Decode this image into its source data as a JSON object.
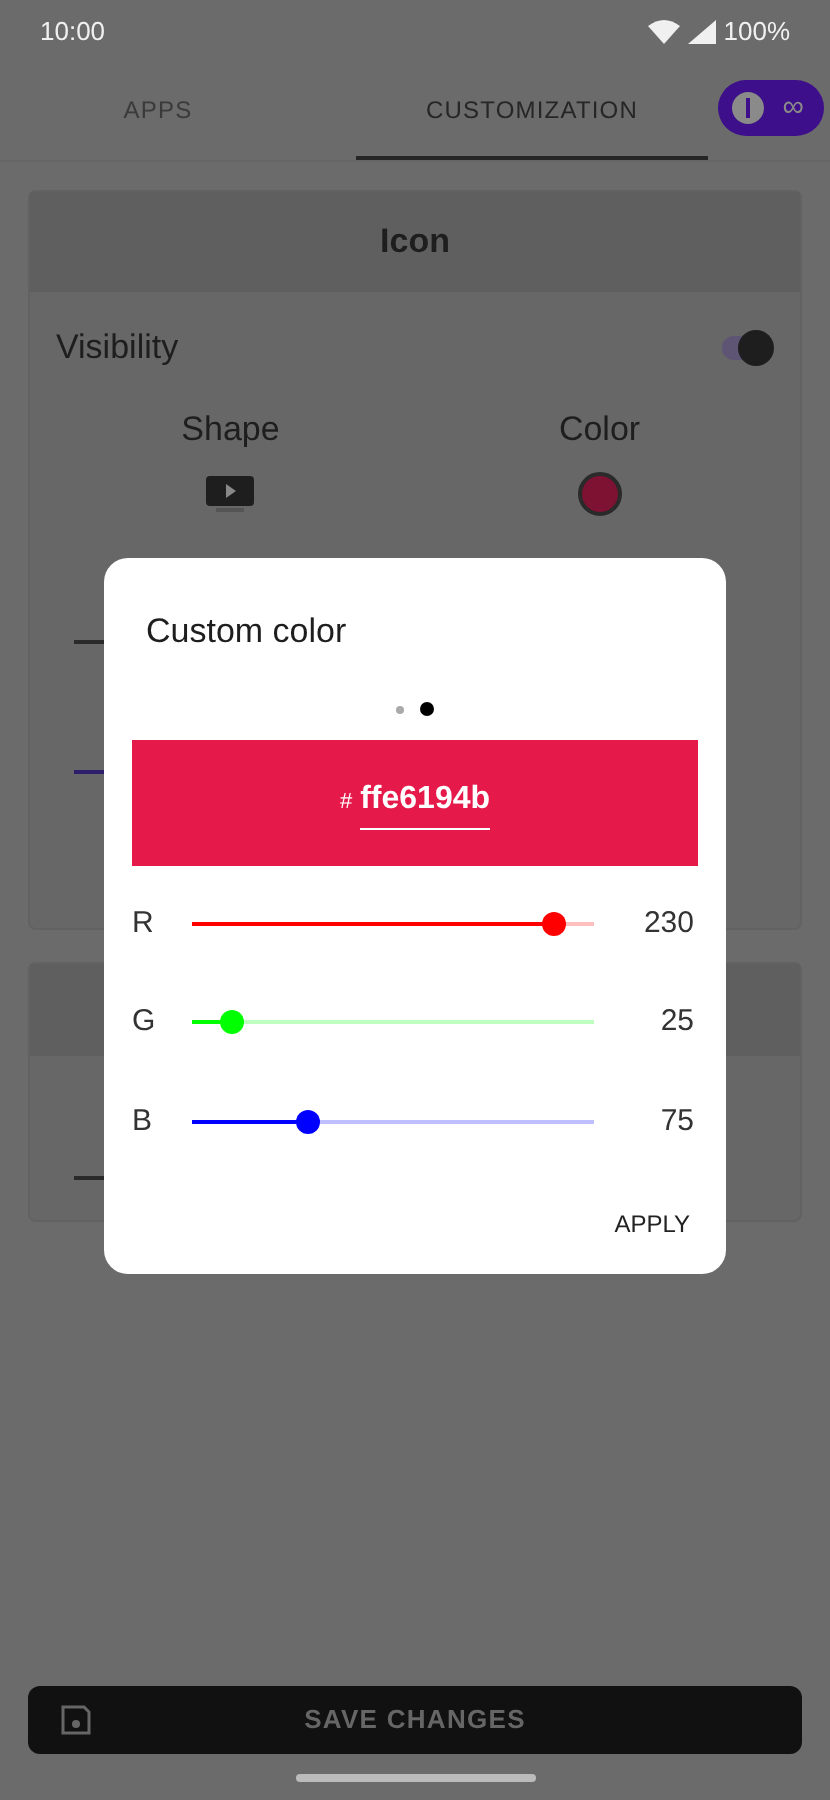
{
  "status_bar": {
    "time": "10:00",
    "battery": "100%"
  },
  "tabs": [
    {
      "label": "APPS",
      "selected": false
    },
    {
      "label": "CUSTOMIZATION",
      "selected": true
    }
  ],
  "premium_badge": {
    "label": "∞"
  },
  "icon_card": {
    "title": "Icon",
    "visibility": {
      "label": "Visibility",
      "on": true
    },
    "shape": {
      "label": "Shape"
    },
    "color": {
      "label": "Color",
      "color": "#7d1232"
    }
  },
  "dialog": {
    "title": "Custom color",
    "pages": [
      {
        "selected": false
      },
      {
        "selected": true
      }
    ],
    "swatch": {
      "color": "#e6194b",
      "prefix": "#",
      "value": "ffe6194b"
    },
    "channels": [
      {
        "name": "R",
        "level": 0.9,
        "reading": "230",
        "color": "#ff0000"
      },
      {
        "name": "G",
        "level": 0.1,
        "reading": "25",
        "color": "#00ff00"
      },
      {
        "name": "B",
        "level": 0.29,
        "reading": "75",
        "color": "#0000ff"
      }
    ],
    "apply": "APPLY"
  },
  "save_button": {
    "label": "SAVE CHANGES"
  }
}
